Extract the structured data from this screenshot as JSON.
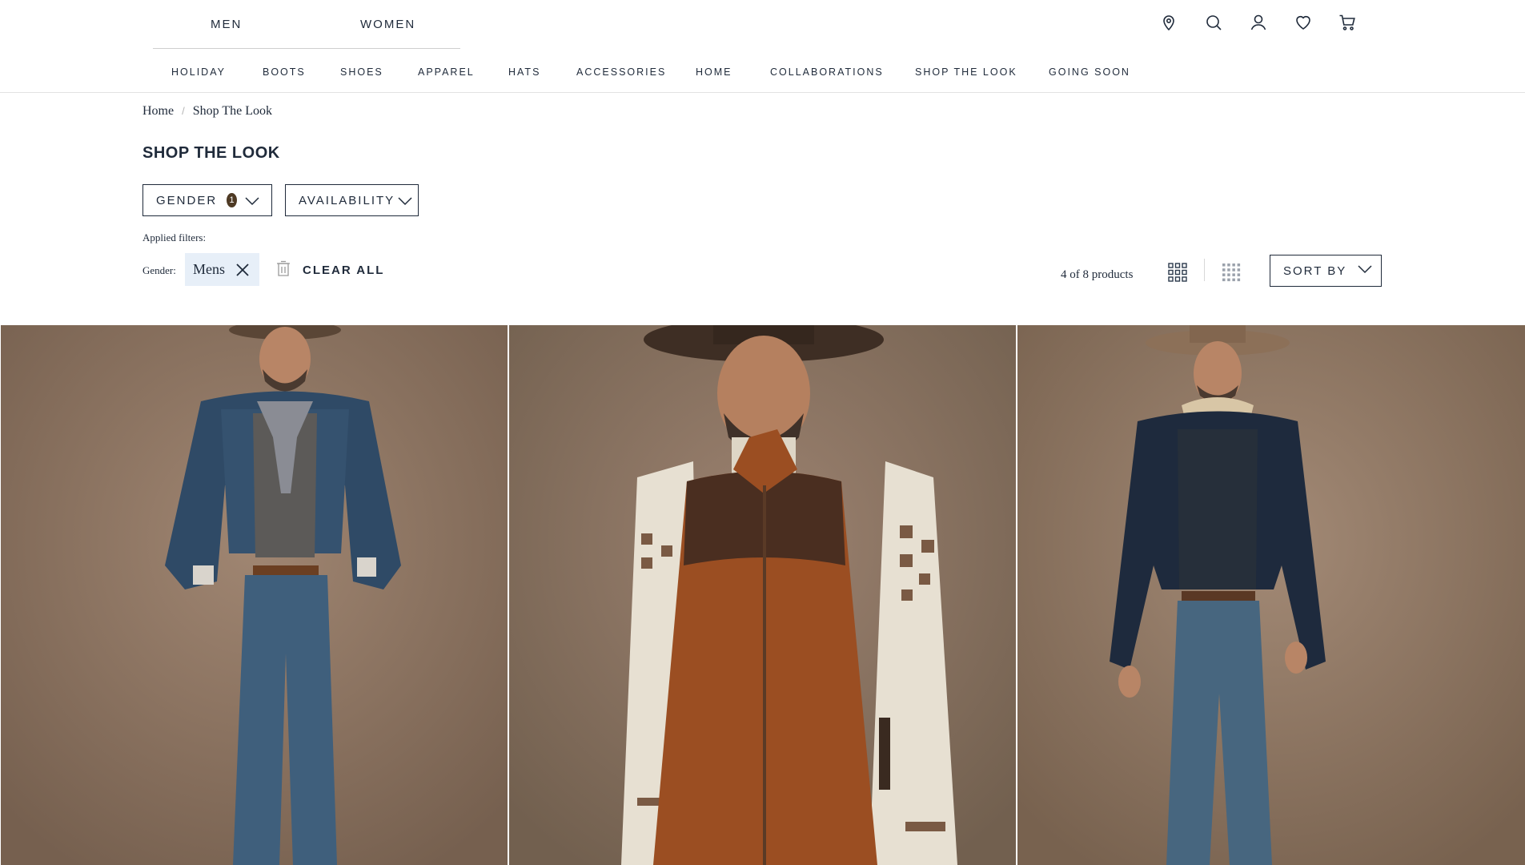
{
  "header": {
    "gender_tabs": [
      "MEN",
      "WOMEN"
    ],
    "utility_icons": [
      "location-pin-icon",
      "search-icon",
      "account-icon",
      "wishlist-heart-icon",
      "cart-icon"
    ],
    "nav": [
      "HOLIDAY",
      "BOOTS",
      "SHOES",
      "APPAREL",
      "HATS",
      "ACCESSORIES",
      "HOME",
      "COLLABORATIONS",
      "SHOP THE LOOK",
      "GOING SOON"
    ]
  },
  "breadcrumb": {
    "home": "Home",
    "separator": "/",
    "current": "Shop The Look"
  },
  "page_title": "SHOP THE LOOK",
  "filters": {
    "gender": {
      "label": "GENDER",
      "count": "1"
    },
    "availability": {
      "label": "AVAILABILITY"
    }
  },
  "applied_filters": {
    "label": "Applied filters:",
    "gender_label": "Gender:",
    "chip": "Mens",
    "clear_all": "CLEAR ALL"
  },
  "toolbar": {
    "product_count": "4 of 8 products",
    "grid_views": [
      "grid-3-icon",
      "grid-4-icon"
    ],
    "sort_label": "SORT BY"
  },
  "products": [
    {
      "image": "cowboy-denim-jacket-scarf-photo"
    },
    {
      "image": "cowboy-suede-vest-fairisle-sweater-photo"
    },
    {
      "image": "cowboy-dark-denim-sherpa-jacket-photo"
    }
  ],
  "colors": {
    "text": "#1f2a3a",
    "badge": "#4e3a24",
    "chip_bg": "#e7eff8",
    "photo_backdrop": "#8c7260"
  }
}
